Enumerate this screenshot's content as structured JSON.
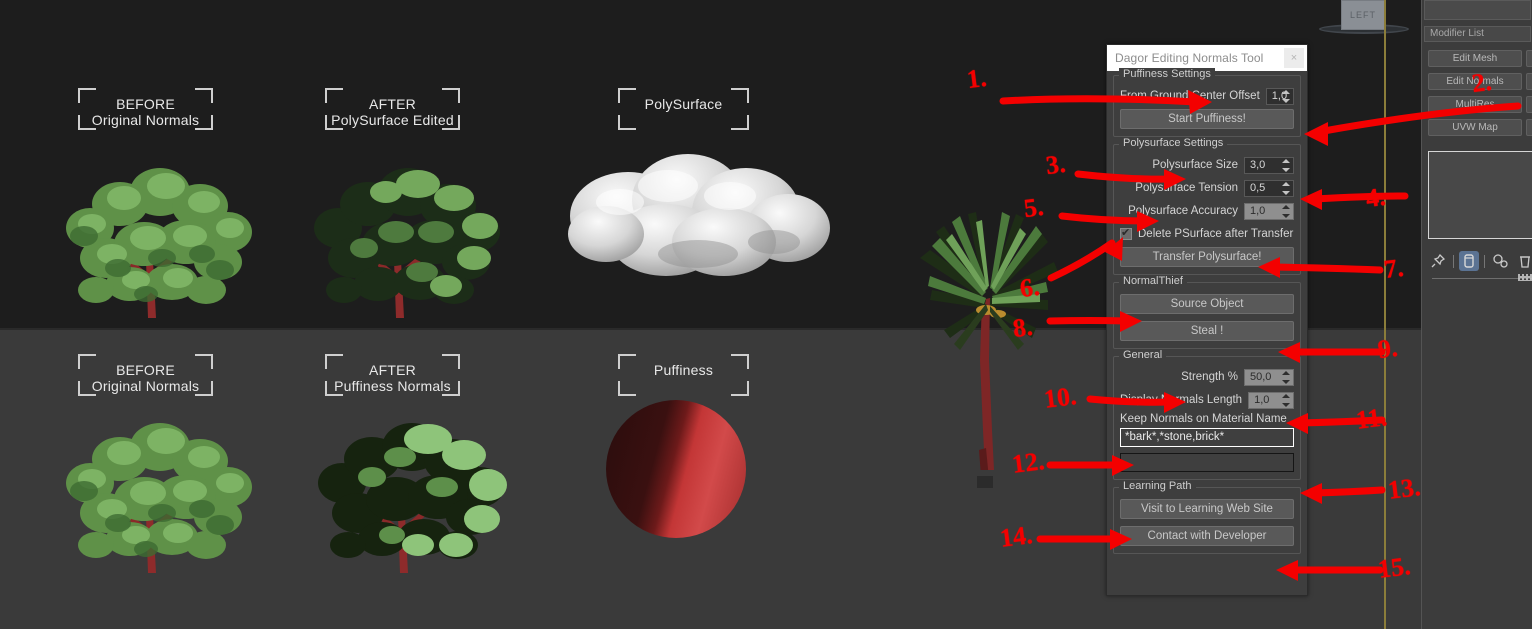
{
  "app": {
    "viewcube_label": "LEFT"
  },
  "viewport": {
    "labels": [
      {
        "line1": "BEFORE",
        "line2": "Original Normals"
      },
      {
        "line1": "AFTER",
        "line2": "PolySurface Edited"
      },
      {
        "line1": "PolySurface",
        "line2": ""
      },
      {
        "line1": "BEFORE",
        "line2": "Original Normals"
      },
      {
        "line1": "AFTER",
        "line2": "Puffiness Normals"
      },
      {
        "line1": "Puffiness",
        "line2": ""
      }
    ]
  },
  "sidebar": {
    "modifier_list_label": "Modifier List",
    "modifiers": [
      {
        "label": "Edit Mesh"
      },
      {
        "label": "Edit Normals"
      },
      {
        "label": "MultiRes"
      },
      {
        "label": "UVW Map"
      }
    ],
    "icons": [
      "pin-icon",
      "modifier-stack-icon",
      "configure-sets-icon",
      "remove-modifier-icon"
    ]
  },
  "tool": {
    "title": "Dagor Editing Normals Tool",
    "close_label": "×",
    "groups": {
      "puffiness": {
        "title": "Puffiness Settings",
        "ground_offset_label": "From Ground Center Offset",
        "ground_offset_value": "1,0",
        "start_button": "Start Puffiness!"
      },
      "polysurface": {
        "title": "Polysurface Settings",
        "size_label": "Polysurface Size",
        "size_value": "3,0",
        "tension_label": "Polysurface Tension",
        "tension_value": "0,5",
        "accuracy_label": "Polysurface Accuracy",
        "accuracy_value": "1,0",
        "delete_checkbox_label": "Delete PSurface after Transfer",
        "transfer_button": "Transfer Polysurface!"
      },
      "normalthief": {
        "title": "NormalThief",
        "source_button": "Source Object",
        "steal_button": "Steal !"
      },
      "general": {
        "title": "General",
        "strength_label": "Strength %",
        "strength_value": "50,0",
        "display_normals_label": "Display Normals Length",
        "display_normals_value": "1,0",
        "keep_normals_label": "Keep Normals on Material Name",
        "keep_normals_value": "*bark*,*stone,brick*",
        "second_field_value": ""
      },
      "learning": {
        "title": "Learning Path",
        "visit_button": "Visit to Learning Web Site",
        "contact_button": "Contact with Developer"
      }
    }
  },
  "annotations": {
    "color": "#f40000",
    "markers": [
      {
        "n": "1."
      },
      {
        "n": "2."
      },
      {
        "n": "3."
      },
      {
        "n": "4."
      },
      {
        "n": "5."
      },
      {
        "n": "6."
      },
      {
        "n": "7."
      },
      {
        "n": "8."
      },
      {
        "n": "9."
      },
      {
        "n": "10."
      },
      {
        "n": "11."
      },
      {
        "n": "12."
      },
      {
        "n": "13."
      },
      {
        "n": "14."
      },
      {
        "n": "15."
      }
    ]
  }
}
